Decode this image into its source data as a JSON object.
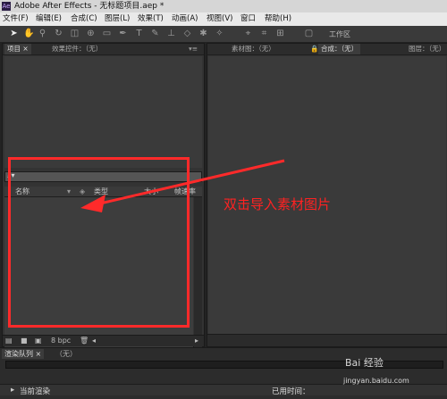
{
  "window": {
    "title": "Adobe After Effects - 无标题项目.aep *",
    "logo": "Ae"
  },
  "menu": [
    "文件(F)",
    "编辑(E)",
    "合成(C)",
    "图层(L)",
    "效果(T)",
    "动画(A)",
    "视图(V)",
    "窗口",
    "帮助(H)"
  ],
  "toolbar": {
    "workspace_label": "工作区"
  },
  "project_panel": {
    "tab_project": "项目 ×",
    "tab_effects": "效果控件：（无）",
    "search_icon": "⌕▾",
    "columns": {
      "name": "名称",
      "type": "类型",
      "size": "大小",
      "fps": "帧速率"
    },
    "bottom": {
      "bpc": "8 bpc"
    }
  },
  "comp_panel": {
    "tab_footage": "素材图：（无）",
    "tab_comp": "合成：（无）",
    "tab_layer": "图层：（无）"
  },
  "render_queue": {
    "tab": "渲染队列 ×",
    "none": "（无）",
    "current_render": "当前渲染",
    "elapsed": "已用时间："
  },
  "annotation": "双击导入素材图片",
  "watermark": {
    "brand": "Bai 经验",
    "url": "jingyan.baidu.com"
  },
  "colors": {
    "highlight": "#ff2a2a",
    "annotation": "#ff2222"
  }
}
